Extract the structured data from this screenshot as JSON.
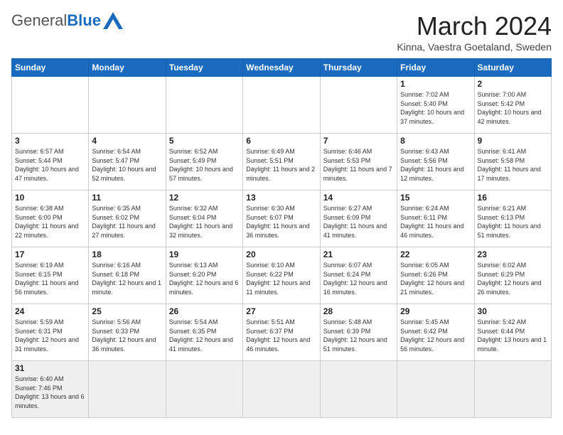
{
  "header": {
    "logo_general": "General",
    "logo_blue": "Blue",
    "month_title": "March 2024",
    "location": "Kinna, Vaestra Goetaland, Sweden"
  },
  "weekdays": [
    "Sunday",
    "Monday",
    "Tuesday",
    "Wednesday",
    "Thursday",
    "Friday",
    "Saturday"
  ],
  "weeks": [
    [
      {
        "day": "",
        "info": ""
      },
      {
        "day": "",
        "info": ""
      },
      {
        "day": "",
        "info": ""
      },
      {
        "day": "",
        "info": ""
      },
      {
        "day": "",
        "info": ""
      },
      {
        "day": "1",
        "info": "Sunrise: 7:02 AM\nSunset: 5:40 PM\nDaylight: 10 hours and 37 minutes."
      },
      {
        "day": "2",
        "info": "Sunrise: 7:00 AM\nSunset: 5:42 PM\nDaylight: 10 hours and 42 minutes."
      }
    ],
    [
      {
        "day": "3",
        "info": "Sunrise: 6:57 AM\nSunset: 5:44 PM\nDaylight: 10 hours and 47 minutes."
      },
      {
        "day": "4",
        "info": "Sunrise: 6:54 AM\nSunset: 5:47 PM\nDaylight: 10 hours and 52 minutes."
      },
      {
        "day": "5",
        "info": "Sunrise: 6:52 AM\nSunset: 5:49 PM\nDaylight: 10 hours and 57 minutes."
      },
      {
        "day": "6",
        "info": "Sunrise: 6:49 AM\nSunset: 5:51 PM\nDaylight: 11 hours and 2 minutes."
      },
      {
        "day": "7",
        "info": "Sunrise: 6:46 AM\nSunset: 5:53 PM\nDaylight: 11 hours and 7 minutes."
      },
      {
        "day": "8",
        "info": "Sunrise: 6:43 AM\nSunset: 5:56 PM\nDaylight: 11 hours and 12 minutes."
      },
      {
        "day": "9",
        "info": "Sunrise: 6:41 AM\nSunset: 5:58 PM\nDaylight: 11 hours and 17 minutes."
      }
    ],
    [
      {
        "day": "10",
        "info": "Sunrise: 6:38 AM\nSunset: 6:00 PM\nDaylight: 11 hours and 22 minutes."
      },
      {
        "day": "11",
        "info": "Sunrise: 6:35 AM\nSunset: 6:02 PM\nDaylight: 11 hours and 27 minutes."
      },
      {
        "day": "12",
        "info": "Sunrise: 6:32 AM\nSunset: 6:04 PM\nDaylight: 11 hours and 32 minutes."
      },
      {
        "day": "13",
        "info": "Sunrise: 6:30 AM\nSunset: 6:07 PM\nDaylight: 11 hours and 36 minutes."
      },
      {
        "day": "14",
        "info": "Sunrise: 6:27 AM\nSunset: 6:09 PM\nDaylight: 11 hours and 41 minutes."
      },
      {
        "day": "15",
        "info": "Sunrise: 6:24 AM\nSunset: 6:11 PM\nDaylight: 11 hours and 46 minutes."
      },
      {
        "day": "16",
        "info": "Sunrise: 6:21 AM\nSunset: 6:13 PM\nDaylight: 11 hours and 51 minutes."
      }
    ],
    [
      {
        "day": "17",
        "info": "Sunrise: 6:19 AM\nSunset: 6:15 PM\nDaylight: 11 hours and 56 minutes."
      },
      {
        "day": "18",
        "info": "Sunrise: 6:16 AM\nSunset: 6:18 PM\nDaylight: 12 hours and 1 minute."
      },
      {
        "day": "19",
        "info": "Sunrise: 6:13 AM\nSunset: 6:20 PM\nDaylight: 12 hours and 6 minutes."
      },
      {
        "day": "20",
        "info": "Sunrise: 6:10 AM\nSunset: 6:22 PM\nDaylight: 12 hours and 11 minutes."
      },
      {
        "day": "21",
        "info": "Sunrise: 6:07 AM\nSunset: 6:24 PM\nDaylight: 12 hours and 16 minutes."
      },
      {
        "day": "22",
        "info": "Sunrise: 6:05 AM\nSunset: 6:26 PM\nDaylight: 12 hours and 21 minutes."
      },
      {
        "day": "23",
        "info": "Sunrise: 6:02 AM\nSunset: 6:29 PM\nDaylight: 12 hours and 26 minutes."
      }
    ],
    [
      {
        "day": "24",
        "info": "Sunrise: 5:59 AM\nSunset: 6:31 PM\nDaylight: 12 hours and 31 minutes."
      },
      {
        "day": "25",
        "info": "Sunrise: 5:56 AM\nSunset: 6:33 PM\nDaylight: 12 hours and 36 minutes."
      },
      {
        "day": "26",
        "info": "Sunrise: 5:54 AM\nSunset: 6:35 PM\nDaylight: 12 hours and 41 minutes."
      },
      {
        "day": "27",
        "info": "Sunrise: 5:51 AM\nSunset: 6:37 PM\nDaylight: 12 hours and 46 minutes."
      },
      {
        "day": "28",
        "info": "Sunrise: 5:48 AM\nSunset: 6:39 PM\nDaylight: 12 hours and 51 minutes."
      },
      {
        "day": "29",
        "info": "Sunrise: 5:45 AM\nSunset: 6:42 PM\nDaylight: 12 hours and 56 minutes."
      },
      {
        "day": "30",
        "info": "Sunrise: 5:42 AM\nSunset: 6:44 PM\nDaylight: 13 hours and 1 minute."
      }
    ],
    [
      {
        "day": "31",
        "info": "Sunrise: 6:40 AM\nSunset: 7:46 PM\nDaylight: 13 hours and 6 minutes."
      },
      {
        "day": "",
        "info": ""
      },
      {
        "day": "",
        "info": ""
      },
      {
        "day": "",
        "info": ""
      },
      {
        "day": "",
        "info": ""
      },
      {
        "day": "",
        "info": ""
      },
      {
        "day": "",
        "info": ""
      }
    ]
  ]
}
